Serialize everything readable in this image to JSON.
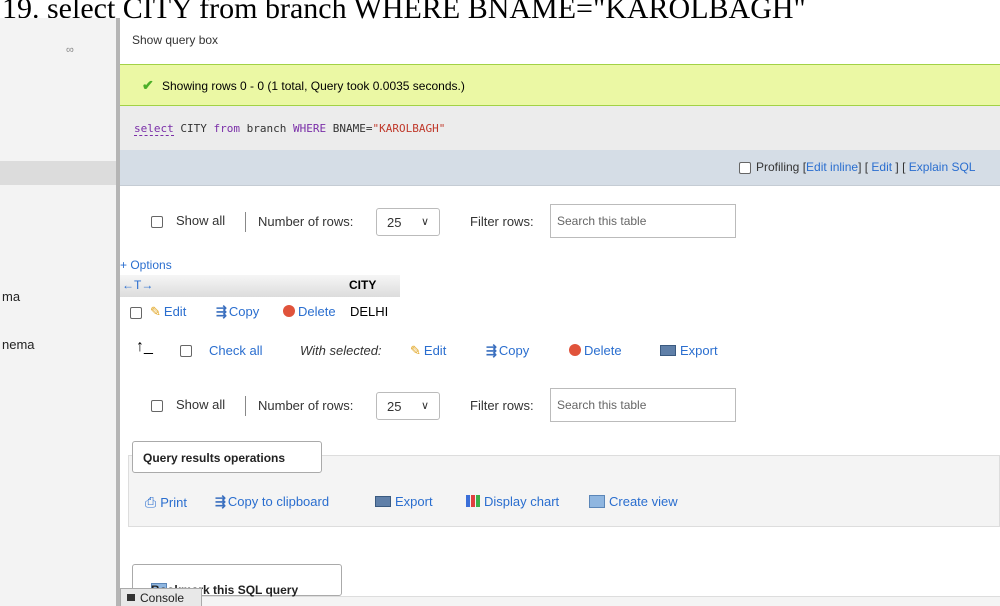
{
  "caption": "19. select CITY from branch WHERE BNAME=\"KAROLBAGH\"",
  "sidebar": {
    "items": [
      {
        "label": "ma"
      },
      {
        "label": "nema"
      }
    ]
  },
  "show_query_box": "Show query box",
  "success_message": "Showing rows 0 - 0 (1 total, Query took 0.0035 seconds.)",
  "sql": {
    "kw_select": "select",
    "col": "CITY",
    "kw_from": "from",
    "table": "branch",
    "kw_where": "WHERE",
    "cond": "BNAME=",
    "value": "\"KAROLBAGH\""
  },
  "profiling": {
    "label": "Profiling",
    "edit_inline": "Edit inline",
    "edit": "Edit",
    "explain": "Explain SQL"
  },
  "nav": {
    "show_all": "Show all",
    "number_of_rows": "Number of rows:",
    "rows_value": "25",
    "filter_rows": "Filter rows:",
    "search_placeholder": "Search this table"
  },
  "options_link": "+ Options",
  "table": {
    "sort_arrows": "←T→",
    "column": "CITY",
    "rows": [
      {
        "city": "DELHI"
      }
    ]
  },
  "row_actions": {
    "edit": "Edit",
    "copy": "Copy",
    "delete": "Delete"
  },
  "bulk": {
    "check_all": "Check all",
    "with_selected": "With selected:",
    "edit": "Edit",
    "copy": "Copy",
    "delete": "Delete",
    "export": "Export"
  },
  "query_ops": {
    "title": "Query results operations",
    "print": "Print",
    "copy_clipboard": "Copy to clipboard",
    "export": "Export",
    "display_chart": "Display chart",
    "create_view": "Create view"
  },
  "bookmark": "Bookmark this SQL query",
  "console": "Console",
  "colors": {
    "success_bg": "#ebf8a4",
    "link": "#2a6ecf",
    "keyword": "#7a2ea8",
    "string": "#c0392b"
  }
}
